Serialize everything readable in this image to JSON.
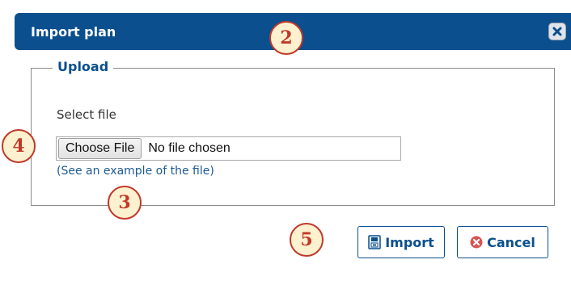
{
  "dialog": {
    "title": "Import plan",
    "close_icon": "close-icon"
  },
  "upload": {
    "legend": "Upload",
    "select_label": "Select file",
    "choose_button": "Choose File",
    "file_status": "No file chosen",
    "example_link": "(See an example of the file)"
  },
  "actions": {
    "import_label": "Import",
    "import_icon": "import-icon",
    "cancel_label": "Cancel",
    "cancel_icon": "cancel-icon"
  },
  "annotations": {
    "badge_2": "2",
    "badge_3": "3",
    "badge_4": "4",
    "badge_5": "5"
  },
  "colors": {
    "titlebar": "#0b4f8e",
    "accent": "#0b4f8e",
    "badge_border": "#c0392b",
    "badge_fill": "#fdf1cf",
    "cancel_icon": "#d9534f"
  }
}
